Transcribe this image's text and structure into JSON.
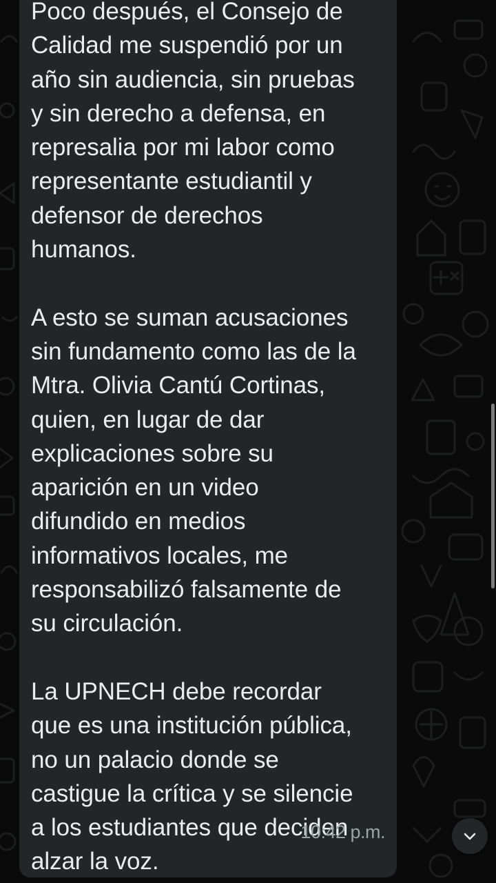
{
  "chat": {
    "message": {
      "paragraphs": [
        "Poco después, el Consejo de Calidad me suspendió por un año sin audiencia, sin pruebas y sin derecho a defensa, en represalia por mi labor como representante estudiantil y defensor de derechos humanos.",
        "A esto se suman acusaciones sin fundamento como las de la Mtra. Olivia Cantú Cortinas, quien, en lugar de dar explicaciones sobre su aparición en un video difundido en medios informativos locales, me responsabilizó falsamente de su circulación.",
        "La UPNECH debe recordar que es una institución pública, no un palacio donde se castigue la crítica y se silencie a los estudiantes que deciden alzar la voz."
      ],
      "lines": [
        "Poco después, el Consejo de",
        "Calidad me suspendió por un",
        "año sin audiencia, sin pruebas",
        "y sin derecho a defensa, en",
        "represalia por mi labor como",
        "representante estudiantil y",
        "defensor de derechos",
        "humanos.",
        "",
        "A esto se suman acusaciones",
        "sin fundamento como las de la",
        "Mtra. Olivia Cantú Cortinas,",
        "quien, en lugar de dar",
        "explicaciones sobre su",
        "aparición en un video",
        "difundido en medios",
        "informativos locales, me",
        "responsabilizó falsamente de",
        "su circulación.",
        "",
        "La UPNECH debe recordar",
        "que es una institución pública,",
        "no un palacio donde se",
        "castigue la crítica y se silencie",
        "a los estudiantes que deciden",
        "alzar la voz."
      ],
      "time": "10:42 p.m."
    }
  },
  "icons": {
    "scroll_down": "chevron-down-icon"
  },
  "colors": {
    "background": "#0a0a0a",
    "bubble": "#232626",
    "text": "#e9edef",
    "timestamp": "#9aa4a6",
    "doodle": "#1c1c1c"
  }
}
